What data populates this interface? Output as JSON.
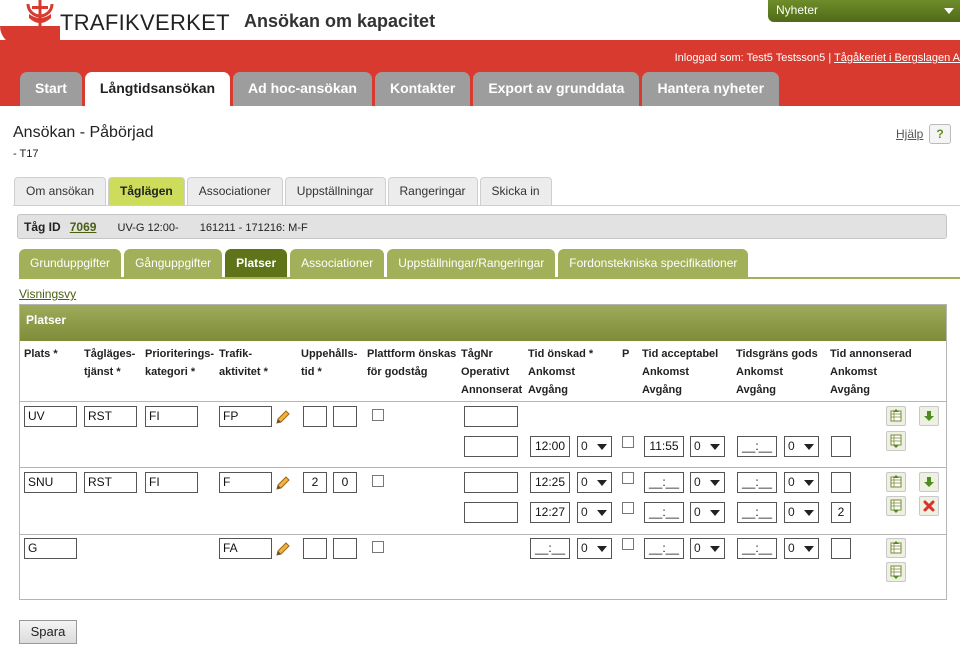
{
  "header": {
    "brand": "TRAFIKVERKET",
    "app_title": "Ansökan om kapacitet",
    "news_label": "Nyheter",
    "login_prefix": "Inloggad som: Test5 Testsson5 |",
    "login_org": "Tågåkeriet i Bergslagen A"
  },
  "main_tabs": [
    "Start",
    "Långtidsansökan",
    "Ad hoc-ansökan",
    "Kontakter",
    "Export av grunddata",
    "Hantera nyheter"
  ],
  "page": {
    "title": "Ansökan - Påbörjad",
    "subtitle": "- T17",
    "help_label": "Hjälp",
    "help_icon": "?"
  },
  "sub_tabs": [
    "Om ansökan",
    "Tåglägen",
    "Associationer",
    "Uppställningar",
    "Rangeringar",
    "Skicka in"
  ],
  "train": {
    "label": "Tåg ID",
    "id": "7069",
    "route": "UV-G 12:00-",
    "period": "161211 - 171216: M-F"
  },
  "group_tabs": [
    "Grunduppgifter",
    "Gånguppgifter",
    "Platser",
    "Associationer",
    "Uppställningar/Rangeringar",
    "Fordonstekniska specifikationer"
  ],
  "view_link": "Visningsvy",
  "panel_title": "Platser",
  "columns": {
    "plats": [
      "Plats *"
    ],
    "tjanst": [
      "Tågläges-",
      "tjänst *"
    ],
    "prio": [
      "Prioriterings-",
      "kategori *"
    ],
    "trafik": [
      "Trafik-",
      "aktivitet *"
    ],
    "uppehall": [
      "Uppehålls-",
      "tid *"
    ],
    "plattform": [
      "Plattform önskas",
      "för godståg"
    ],
    "tagnr": [
      "TågNr",
      "Operativt",
      "Annonserat"
    ],
    "onskad": [
      "Tid önskad *",
      "Ankomst",
      "Avgång"
    ],
    "p": [
      "P"
    ],
    "acceptabel": [
      "Tid acceptabel",
      "Ankomst",
      "Avgång"
    ],
    "gods": [
      "Tidsgräns gods",
      "Ankomst",
      "Avgång"
    ],
    "annonserad": [
      "Tid annonserad",
      "Ankomst",
      "Avgång"
    ]
  },
  "rows": [
    {
      "plats": "UV",
      "tjanst": "RST",
      "prio": "FI",
      "trafik": "FP",
      "uppehall_min": "",
      "uppehall_sek": "",
      "avg_onskad": "12:00",
      "avg_onskad_sel": "0",
      "avg_acc": "11:55",
      "avg_acc_sel": "0",
      "avg_gods": "__:__",
      "avg_gods_sel": "0",
      "avg_annons": ""
    },
    {
      "plats": "SNU",
      "tjanst": "RST",
      "prio": "FI",
      "trafik": "F",
      "uppehall_min": "2",
      "uppehall_sek": "0",
      "ank_onskad": "12:25",
      "ank_onskad_sel": "0",
      "ank_acc": "__:__",
      "ank_acc_sel": "0",
      "ank_gods": "__:__",
      "ank_gods_sel": "0",
      "ank_annons": "",
      "avg_onskad": "12:27",
      "avg_onskad_sel": "0",
      "avg_acc": "__:__",
      "avg_acc_sel": "0",
      "avg_gods": "__:__",
      "avg_gods_sel": "0",
      "avg_annons": "2"
    },
    {
      "plats": "G",
      "trafik": "FA",
      "uppehall_min": "",
      "uppehall_sek": "",
      "ank_onskad": "__:__",
      "ank_onskad_sel": "0",
      "ank_acc": "__:__",
      "ank_acc_sel": "0",
      "ank_gods": "__:__",
      "ank_gods_sel": "0",
      "ank_annons": ""
    }
  ],
  "save_label": "Spara",
  "colors": {
    "red": "#d83a2f",
    "green_dark": "#5f7419",
    "green_light": "#a2b05a",
    "yellow_tab": "#cddc5b"
  },
  "icons": [
    "trafikverket-logo-icon",
    "chevron-down-icon",
    "pencil-icon",
    "insert-above-icon",
    "insert-below-icon",
    "move-down-icon",
    "delete-icon"
  ]
}
